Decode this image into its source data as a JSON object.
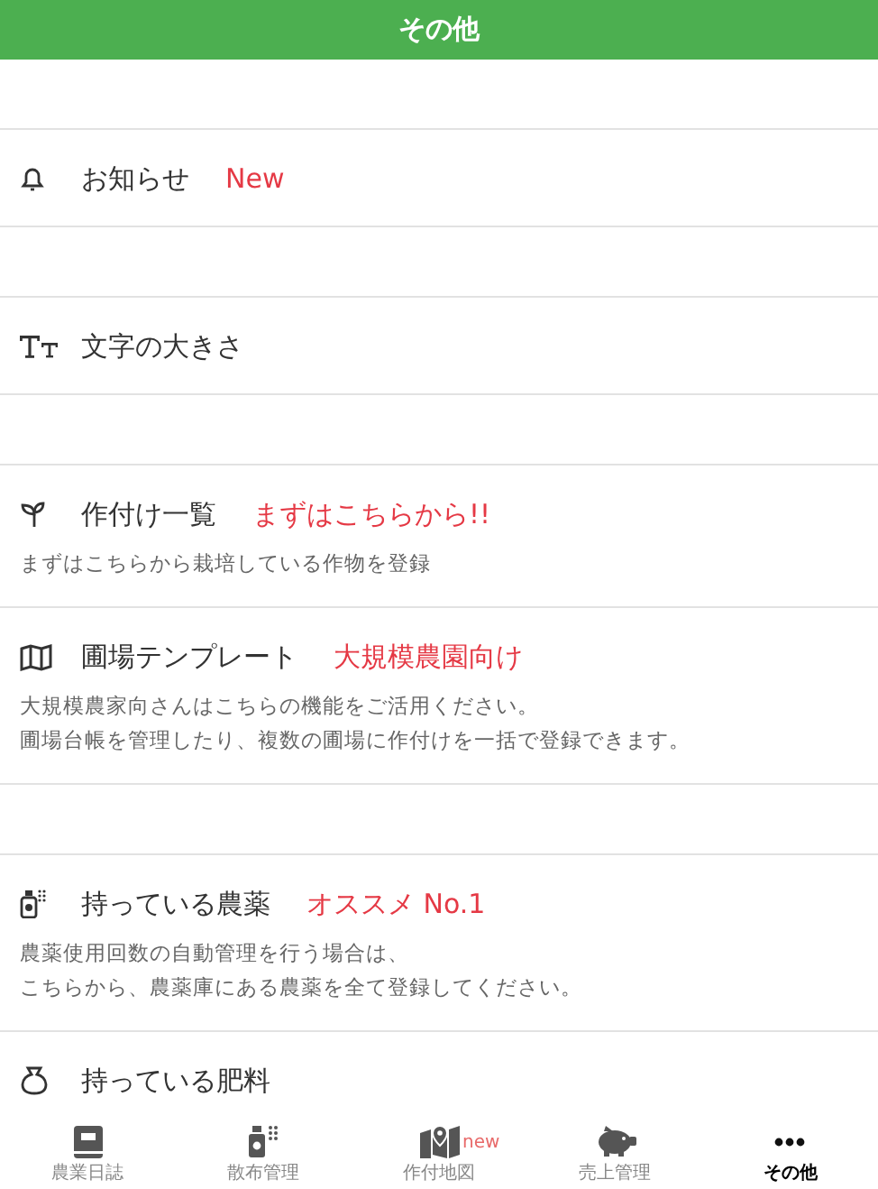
{
  "header": {
    "title": "その他"
  },
  "groups": [
    {
      "items": [
        {
          "title": "お知らせ",
          "tag": "New"
        }
      ]
    },
    {
      "items": [
        {
          "title": "文字の大きさ"
        }
      ]
    },
    {
      "items": [
        {
          "title": "作付け一覧",
          "tag": "まずはこちらから!!",
          "description": [
            "まずはこちらから栽培している作物を登録"
          ]
        },
        {
          "title": "圃場テンプレート",
          "tag": "大規模農園向け",
          "description": [
            "大規模農家向さんはこちらの機能をご活用ください。",
            "圃場台帳を管理したり、複数の圃場に作付けを一括で登録できます。"
          ]
        }
      ]
    },
    {
      "items": [
        {
          "title": "持っている農薬",
          "tag": "オススメ No.1",
          "description": [
            "農薬使用回数の自動管理を行う場合は、",
            "こちらから、農薬庫にある農薬を全て登録してください。"
          ]
        },
        {
          "title": "持っている肥料"
        }
      ]
    }
  ],
  "tabs": [
    {
      "label": "農業日誌",
      "selected": false
    },
    {
      "label": "散布管理",
      "selected": false
    },
    {
      "label": "作付地図",
      "selected": false,
      "badge": "new"
    },
    {
      "label": "売上管理",
      "selected": false
    },
    {
      "label": "その他",
      "selected": true
    }
  ]
}
